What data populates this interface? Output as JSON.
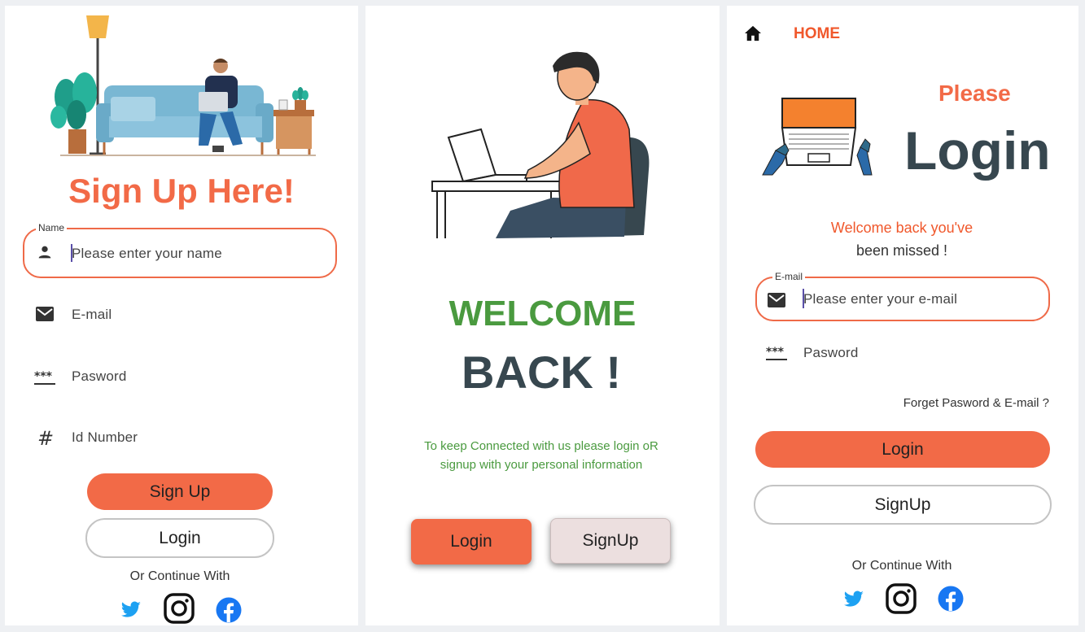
{
  "signup": {
    "title": "Sign Up Here!",
    "name_label": "Name",
    "name_placeholder": "Please enter your name",
    "email_placeholder": "E-mail",
    "password_placeholder": "Pasword",
    "id_placeholder": "Id Number",
    "signup_button": "Sign Up",
    "login_button": "Login",
    "continue_text": "Or Continue With",
    "icons": [
      "person-icon",
      "mail-icon",
      "password-icon",
      "hash-icon"
    ],
    "social": [
      "twitter-icon",
      "instagram-icon",
      "facebook-icon"
    ]
  },
  "welcome": {
    "title_line1": "WELCOME",
    "title_line2": "BACK !",
    "subtitle_line1": "To keep Connected with us please login oR",
    "subtitle_line2": "signup with your personal information",
    "login_button": "Login",
    "signup_button": "SignUp"
  },
  "login": {
    "nav_home": "HOME",
    "please": "Please",
    "login_title": "Login",
    "welcome_line1": "Welcome back you've",
    "welcome_line2": "been missed !",
    "email_label": "E-mail",
    "email_placeholder": "Please enter your e-mail",
    "password_placeholder": "Pasword",
    "forget": "Forget Pasword & E-mail ?",
    "login_button": "Login",
    "signup_button": "SignUp",
    "continue_text": "Or Continue With"
  },
  "colors": {
    "accent": "#f26a47",
    "welcome_green": "#4a9a3f",
    "dark_slate": "#37474f",
    "twitter": "#1da1f2",
    "facebook": "#1877f2"
  }
}
